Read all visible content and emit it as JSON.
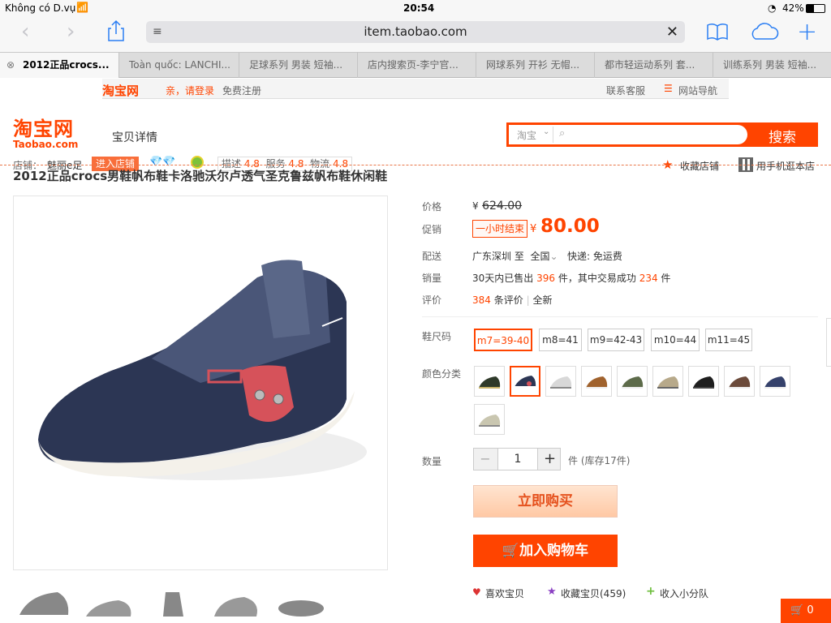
{
  "status": {
    "carrier": "Không có D.vụ",
    "time": "20:54",
    "battery": "42%"
  },
  "browser": {
    "url": "item.taobao.com",
    "tabs": [
      {
        "label": "2012正品crocs..."
      },
      {
        "label": "Toàn quốc: LANCHI..."
      },
      {
        "label": "足球系列 男装 短袖..."
      },
      {
        "label": "店内搜索页-李宁官..."
      },
      {
        "label": "网球系列 开衫 无帽..."
      },
      {
        "label": "都市轻运动系列 套..."
      },
      {
        "label": "训练系列 男装 短袖..."
      }
    ]
  },
  "sitebar": {
    "logo": "淘宝网",
    "login": "亲，请登录",
    "register": "免费注册",
    "service": "联系客服",
    "nav": "网站导航"
  },
  "header": {
    "logo_cn": "淘宝网",
    "logo_en": "Taobao.com",
    "section": "宝贝详情",
    "search_scope": "淘宝",
    "search_button": "搜索",
    "shop_label": "店铺：",
    "shop_name": "魅丽e足",
    "enter_shop": "进入店铺",
    "rate_desc_label": "描述",
    "rate_desc": "4.8",
    "rate_service_label": "服务",
    "rate_service": "4.8",
    "rate_ship_label": "物流",
    "rate_ship": "4.8",
    "favorite_shop": "收藏店铺",
    "mobile_shop": "用手机逛本店"
  },
  "product": {
    "title": "2012正品crocs男鞋帆布鞋卡洛驰沃尔卢透气圣克鲁兹帆布鞋休闲鞋",
    "price_label": "价格",
    "currency": "¥",
    "price": "624.00",
    "promo_label": "促销",
    "promo_tag": "一小时结束",
    "promo_price": "80.00",
    "ship_label": "配送",
    "ship_from": "广东深圳",
    "ship_to_word": "至",
    "ship_to": "全国",
    "ship_method": "快递: 免运费",
    "sales_label": "销量",
    "sales_prefix": "30天内已售出",
    "sales_count": "396",
    "sales_mid": "件，其中交易成功",
    "sales_success": "234",
    "sales_suffix": "件",
    "review_label": "评价",
    "review_count": "384",
    "review_text": "条评价",
    "review_sep": "|",
    "review_all": "全新",
    "size_label": "鞋尺码",
    "sizes": [
      "m7=39-40",
      "m8=41",
      "m9=42-43",
      "m10=44",
      "m11=45"
    ],
    "color_label": "颜色分类",
    "qty_label": "数量",
    "qty": "1",
    "qty_minus": "−",
    "qty_plus": "+",
    "qty_unit": "件 (库存17件)",
    "buy_now": "立即购买",
    "add_cart": "加入购物车",
    "like": "喜欢宝贝",
    "collect": "收藏宝贝(459)",
    "team": "收入小分队",
    "cart_count": "0"
  },
  "colors": {
    "accent": "#ff4400",
    "link_blue": "#2a7ef3",
    "navy": "#2c3654"
  }
}
